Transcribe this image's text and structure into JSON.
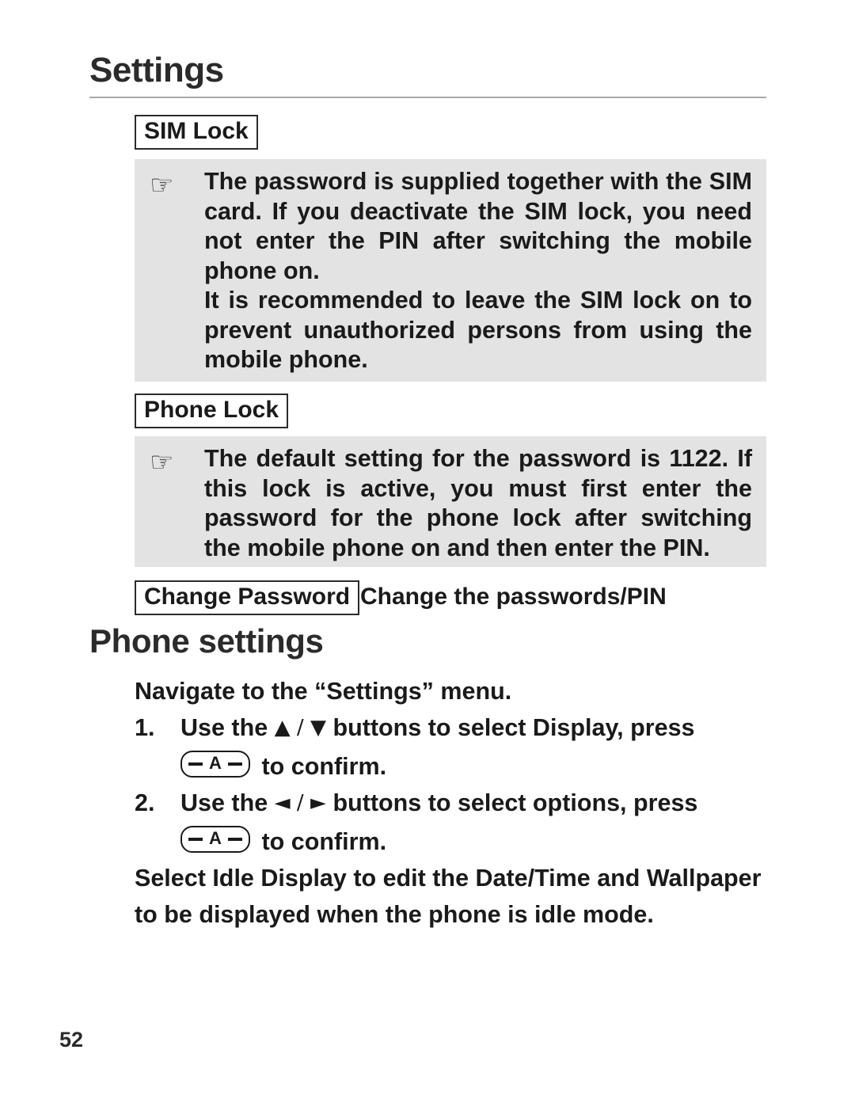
{
  "header": {
    "title": "Settings"
  },
  "sim_lock": {
    "heading": "SIM Lock",
    "icon": "pointing-hand-icon",
    "paragraphs": [
      "The password is supplied together with the SIM card. If you deactivate the SIM lock, you need not enter the PIN after switching the mobile phone on.",
      "It is recommended to leave the SIM lock on to prevent unauthorized persons from using the mobile phone."
    ]
  },
  "phone_lock": {
    "heading": "Phone Lock",
    "icon": "pointing-hand-icon",
    "paragraphs": [
      "The default setting for the password is 1122. If this lock is active, you must first enter the password for the phone lock after switching the mobile phone on and then enter the PIN."
    ]
  },
  "change_password": {
    "label": "Change Password",
    "description": "Change the passwords/PIN"
  },
  "phone_settings": {
    "heading": "Phone settings",
    "intro": "Navigate to the “Settings” menu.",
    "steps": [
      {
        "number": "1.",
        "text_before": "Use the",
        "keys": "▲ / ▼",
        "text_after": "buttons to select Display, press",
        "confirm_prefix": "",
        "confirm_key": "A",
        "confirm_text": "to confirm."
      },
      {
        "number": "2.",
        "text_before": "Use the",
        "keys": "◄ / ►",
        "text_after": "buttons to select options, press",
        "confirm_prefix": "",
        "confirm_key": "A",
        "confirm_text": "to confirm."
      }
    ],
    "closing_line_1": "Select Idle Display to edit the Date/Time and Wallpaper",
    "closing_line_2": "to be displayed when the phone is idle mode."
  },
  "footer": {
    "page_number": "52"
  }
}
